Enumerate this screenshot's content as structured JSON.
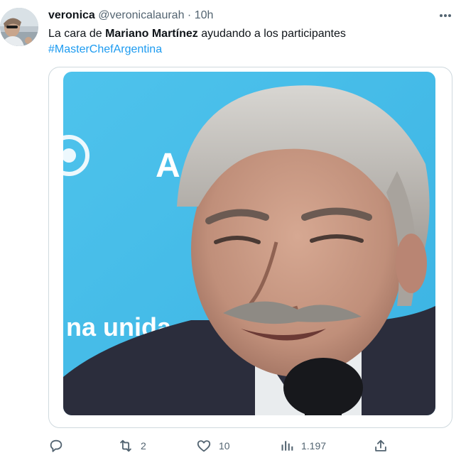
{
  "tweet": {
    "display_name": "veronica",
    "handle": "@veronicalaurah",
    "separator": "·",
    "time": "10h",
    "text_prefix": "La cara de ",
    "text_bold": "Mariano Martínez",
    "text_suffix": " ayudando a los participantes",
    "hashtag": "#MasterChefArgentina"
  },
  "media": {
    "background_text_1": "A",
    "background_text_2": "na unida"
  },
  "actions": {
    "reply_icon": "reply-icon",
    "retweet_count": "2",
    "like_count": "10",
    "views_count": "1.197",
    "share_icon": "share-icon"
  },
  "colors": {
    "text": "#0f1419",
    "secondary": "#536471",
    "link": "#1d9bf0",
    "border": "#cfd9de",
    "photo_background": "#47bde8"
  }
}
